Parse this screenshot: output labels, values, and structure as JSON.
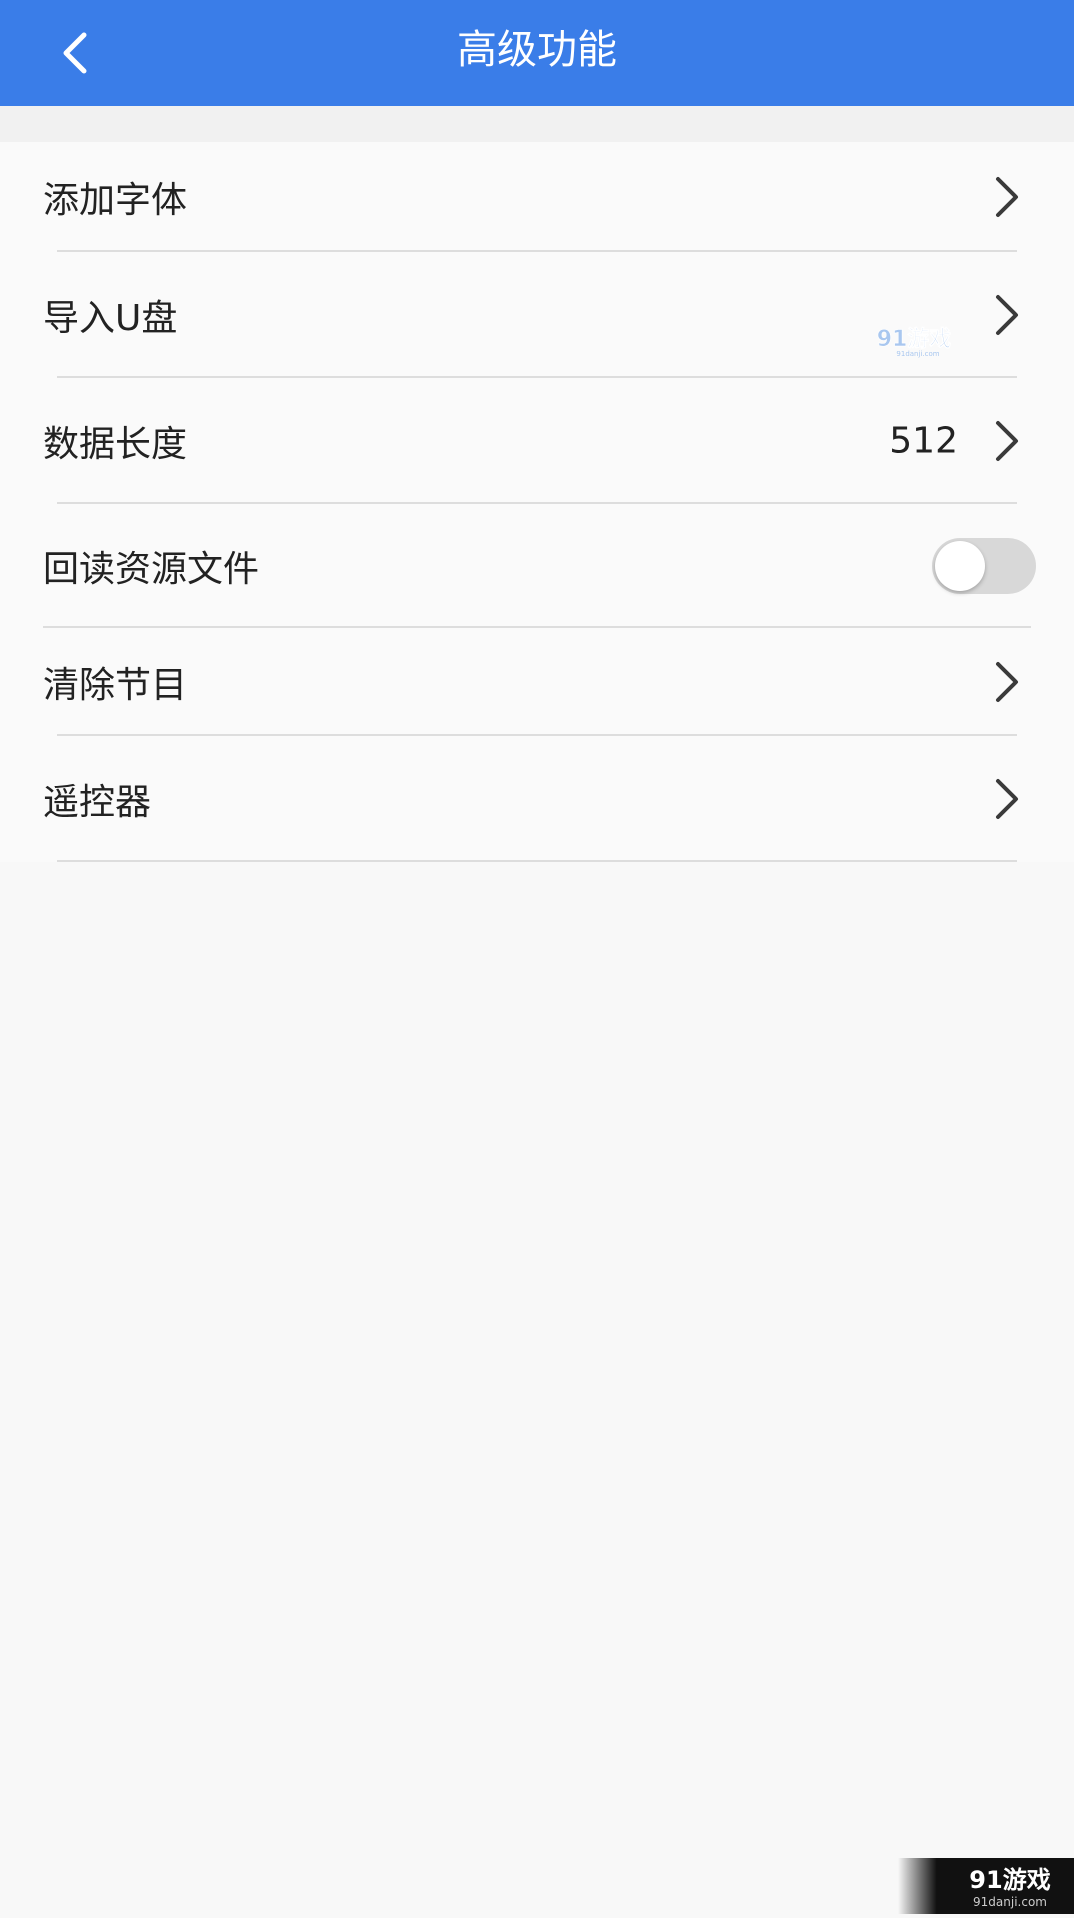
{
  "header": {
    "title": "高级功能",
    "background_color": "#3a7de8"
  },
  "items": [
    {
      "label": "添加字体",
      "value": "",
      "control": "chevron"
    },
    {
      "label": "导入U盘",
      "value": "",
      "control": "chevron"
    },
    {
      "label": "数据长度",
      "value": "512",
      "control": "chevron"
    },
    {
      "label": "回读资源文件",
      "value": "",
      "control": "toggle",
      "toggle_on": false
    },
    {
      "label": "清除节目",
      "value": "",
      "control": "chevron"
    },
    {
      "label": "遥控器",
      "value": "",
      "control": "chevron"
    }
  ],
  "watermark": {
    "brand": "91游戏",
    "domain": "91danji.com"
  }
}
